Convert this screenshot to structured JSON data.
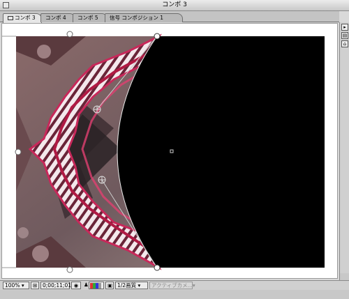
{
  "window": {
    "title": "コンポ 3"
  },
  "tabs": [
    {
      "label": "コンポ 3",
      "active": true
    },
    {
      "label": "コンポ 4",
      "active": false
    },
    {
      "label": "コンポ 5",
      "active": false
    },
    {
      "label": "信号 コンポジション 1",
      "active": false
    }
  ],
  "status": {
    "zoom": "100%",
    "timecode": "0;00;11;01",
    "resolution": "1/2画質",
    "camera": "アクティブカメ..."
  },
  "colors": {
    "accent_magenta": "#c8285a",
    "mask_black": "#000000",
    "chrome": "#d9d9d9"
  },
  "icons": [
    "close-box-icon",
    "comp-tab-icon",
    "panel-menu-icon",
    "region-icon",
    "camera-snapshot-icon",
    "show-snapshot-icon",
    "channel-color-icon",
    "transparency-grid-icon",
    "dropdown-arrow-icon"
  ]
}
